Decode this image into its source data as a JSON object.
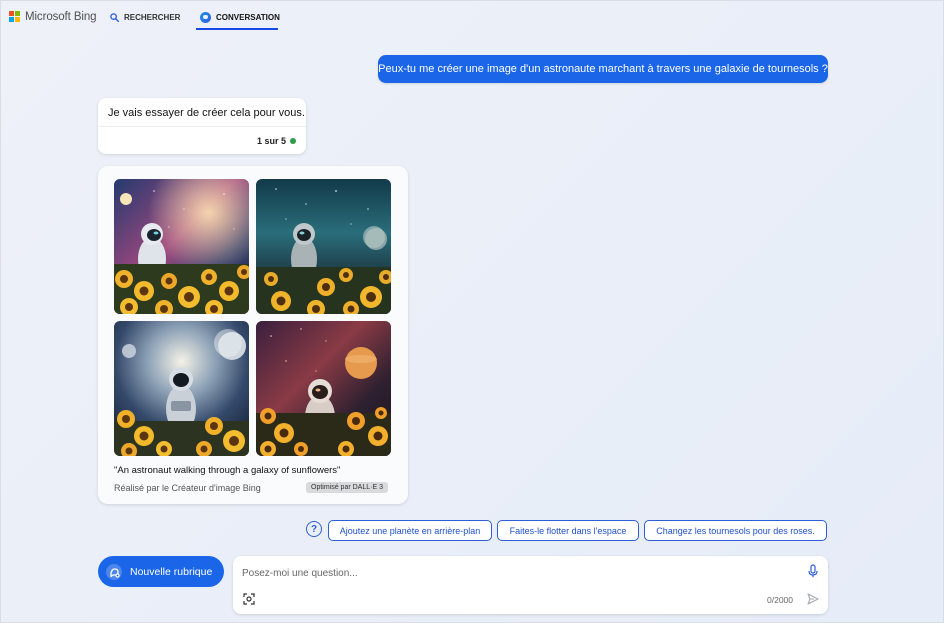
{
  "header": {
    "brand": "Microsoft Bing",
    "brand_colors": [
      "#f25022",
      "#7fba00",
      "#00a4ef",
      "#ffb900"
    ],
    "nav_search_label": "RECHERCHER",
    "nav_chat_label": "CONVERSATION",
    "active_tab": "CONVERSATION"
  },
  "conversation": {
    "user_message": "Peux-tu me créer une image d'un astronaute marchant à travers une galaxie de tournesols ?",
    "bot_message": "Je vais essayer de créer cela pour vous.",
    "turn_counter": "1 sur 5",
    "image_card": {
      "caption": "\"An astronaut walking through a galaxy of sunflowers\"",
      "creator": "Réalisé par le Créateur d'image Bing",
      "badge": "Optimisé par DALL·E 3",
      "images": [
        "astronaut-sunflowers-1",
        "astronaut-sunflowers-2",
        "astronaut-sunflowers-3",
        "astronaut-sunflowers-4"
      ]
    }
  },
  "suggestions": {
    "help_glyph": "?",
    "items": [
      "Ajoutez une planète en arrière-plan",
      "Faites-le flotter dans l'espace",
      "Changez les tournesols pour des roses."
    ]
  },
  "composer": {
    "new_topic_label": "Nouvelle rubrique",
    "placeholder": "Posez-moi une question...",
    "value": "",
    "char_count": "0/2000"
  },
  "colors": {
    "accent": "#1b66e8",
    "chip_border": "#2d5fd9",
    "status_green": "#2e9d4a"
  }
}
